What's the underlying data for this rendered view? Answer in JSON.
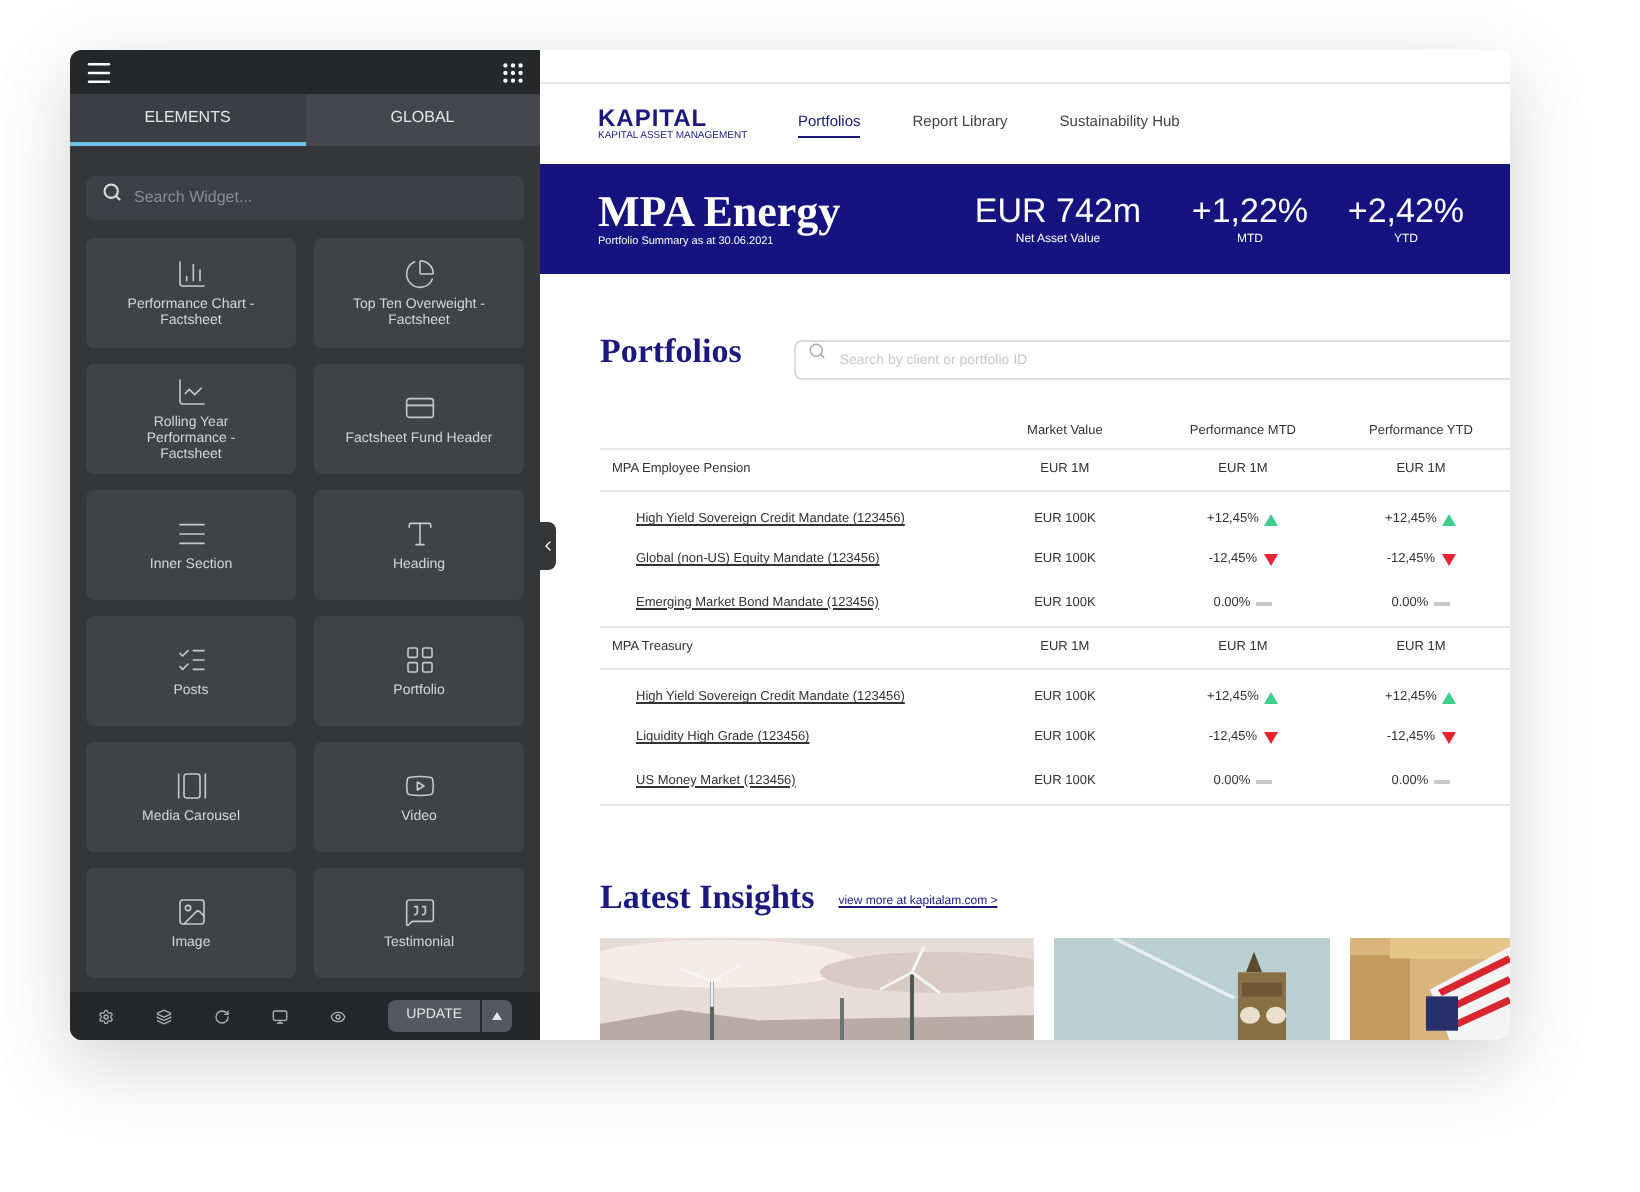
{
  "sidebar": {
    "tabs": [
      {
        "label": "ELEMENTS",
        "selected": true
      },
      {
        "label": "GLOBAL",
        "selected": false
      }
    ],
    "search": {
      "placeholder": "Search Widget..."
    },
    "widgets": [
      {
        "label": "Performance Chart - Factsheet"
      },
      {
        "label": "Top Ten Overweight - Factsheet"
      },
      {
        "label": "Rolling Year Performance - Factsheet"
      },
      {
        "label": "Factsheet Fund Header"
      },
      {
        "label": "Inner Section"
      },
      {
        "label": "Heading"
      },
      {
        "label": "Posts"
      },
      {
        "label": "Portfolio"
      },
      {
        "label": "Media Carousel"
      },
      {
        "label": "Video"
      },
      {
        "label": "Image"
      },
      {
        "label": "Testimonial"
      }
    ],
    "update_button": "UPDATE"
  },
  "header": {
    "logo": "KAPITAL",
    "logo_tagline": "KAPITAL ASSET MANAGEMENT",
    "nav": [
      {
        "label": "Portfolios",
        "selected": true
      },
      {
        "label": "Report Library",
        "selected": false
      },
      {
        "label": "Sustainability Hub",
        "selected": false
      }
    ]
  },
  "banner": {
    "title": "MPA Energy",
    "subtitle": "Portfolio Summary as at 30.06.2021",
    "stats": [
      {
        "value": "EUR 742m",
        "label": "Net Asset Value"
      },
      {
        "value": "+1,22%",
        "label": "MTD"
      },
      {
        "value": "+2,42%",
        "label": "YTD"
      }
    ]
  },
  "portfolios": {
    "title": "Portfolios",
    "search": {
      "placeholder": "Search by client or portfolio ID"
    },
    "columns": [
      "Market Value",
      "Performance MTD",
      "Performance YTD"
    ],
    "rows": [
      {
        "kind": "group",
        "name": "MPA Employee Pension",
        "market_value": "EUR 1M",
        "mtd": {
          "text": "EUR 1M"
        },
        "ytd": {
          "text": "EUR 1M"
        }
      },
      {
        "kind": "item",
        "name": "High Yield Sovereign Credit Mandate (123456)",
        "market_value": "EUR 100K",
        "mtd": {
          "text": "+12,45%",
          "kind": "up"
        },
        "ytd": {
          "text": "+12,45%",
          "kind": "up"
        }
      },
      {
        "kind": "item",
        "name": "Global (non-US) Equity Mandate (123456)",
        "market_value": "EUR 100K",
        "mtd": {
          "text": "-12,45%",
          "kind": "down"
        },
        "ytd": {
          "text": "-12,45%",
          "kind": "down"
        }
      },
      {
        "kind": "item",
        "name": "Emerging Market Bond Mandate (123456)",
        "market_value": "EUR 100K",
        "mtd": {
          "text": "0.00%",
          "kind": "flat"
        },
        "ytd": {
          "text": "0.00%",
          "kind": "flat"
        }
      },
      {
        "kind": "group",
        "name": "MPA Treasury",
        "market_value": "EUR 1M",
        "mtd": {
          "text": "EUR 1M"
        },
        "ytd": {
          "text": "EUR 1M"
        }
      },
      {
        "kind": "item",
        "name": "High Yield Sovereign Credit Mandate (123456)",
        "market_value": "EUR 100K",
        "mtd": {
          "text": "+12,45%",
          "kind": "up"
        },
        "ytd": {
          "text": "+12,45%",
          "kind": "up"
        }
      },
      {
        "kind": "item",
        "name": "Liquidity High Grade (123456)",
        "market_value": "EUR 100K",
        "mtd": {
          "text": "-12,45%",
          "kind": "down"
        },
        "ytd": {
          "text": "-12,45%",
          "kind": "down"
        }
      },
      {
        "kind": "item",
        "name": "US Money Market (123456)",
        "market_value": "EUR 100K",
        "mtd": {
          "text": "0.00%",
          "kind": "flat"
        },
        "ytd": {
          "text": "0.00%",
          "kind": "flat"
        }
      }
    ]
  },
  "insights": {
    "title": "Latest Insights",
    "link": "view more at kapitalam.com >"
  }
}
